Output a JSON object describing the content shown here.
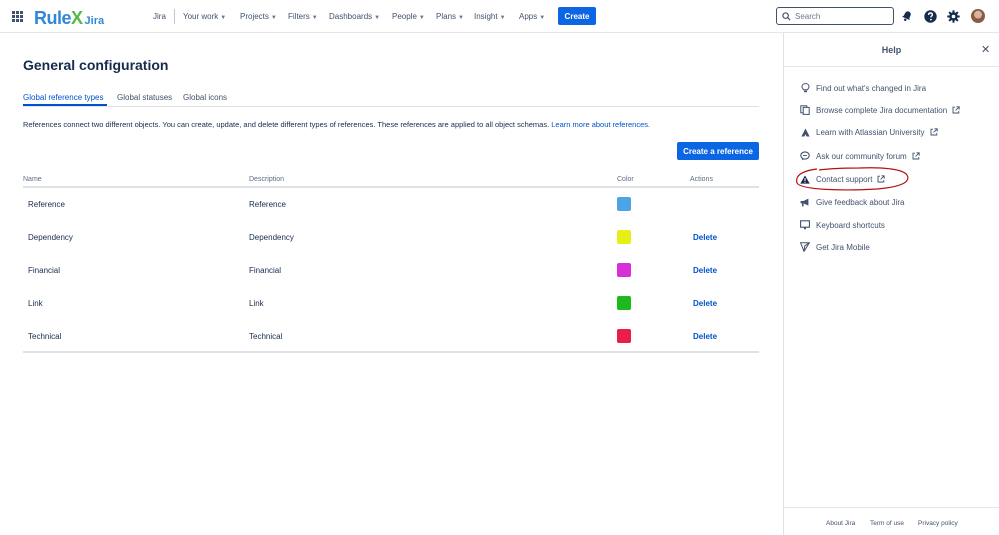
{
  "nav": {
    "brand_main": "Rule",
    "brand_x": "X",
    "brand_product": "Jira",
    "items": [
      {
        "label": "Jira",
        "chevron": false
      },
      {
        "label": "Your work",
        "chevron": true
      },
      {
        "label": "Projects",
        "chevron": true
      },
      {
        "label": "Filters",
        "chevron": true
      },
      {
        "label": "Dashboards",
        "chevron": true
      },
      {
        "label": "People",
        "chevron": true
      },
      {
        "label": "Plans",
        "chevron": true
      },
      {
        "label": "Insight",
        "chevron": true
      },
      {
        "label": "Apps",
        "chevron": true
      }
    ],
    "create_label": "Create",
    "search_placeholder": "Search",
    "icons": [
      "apps-grid-icon",
      "notifications-icon",
      "help-icon",
      "settings-icon",
      "avatar"
    ]
  },
  "page": {
    "title": "General configuration",
    "tabs": [
      {
        "label": "Global reference types",
        "active": true
      },
      {
        "label": "Global statuses",
        "active": false
      },
      {
        "label": "Global icons",
        "active": false
      }
    ],
    "description": "References connect two different objects. You can create, update, and delete different types of references. These references are applied to all object schemas.",
    "description_link": "Learn more about references.",
    "create_reference_label": "Create a reference"
  },
  "table": {
    "headers": {
      "name": "Name",
      "description": "Description",
      "color": "Color",
      "actions": "Actions"
    },
    "rows": [
      {
        "name": "Reference",
        "description": "Reference",
        "color": "#4ca3e6",
        "action": ""
      },
      {
        "name": "Dependency",
        "description": "Dependency",
        "color": "#e6ef16",
        "action": "Delete"
      },
      {
        "name": "Financial",
        "description": "Financial",
        "color": "#d62fd6",
        "action": "Delete"
      },
      {
        "name": "Link",
        "description": "Link",
        "color": "#1dba1d",
        "action": "Delete"
      },
      {
        "name": "Technical",
        "description": "Technical",
        "color": "#ea1c4a",
        "action": "Delete"
      }
    ]
  },
  "help": {
    "title": "Help",
    "items": [
      {
        "label": "Find out what's changed in Jira",
        "icon": "lightbulb-icon",
        "external": false
      },
      {
        "label": "Browse complete Jira documentation",
        "icon": "documentation-icon",
        "external": true
      },
      {
        "label": "Learn with Atlassian University",
        "icon": "atlassian-icon",
        "external": true
      },
      {
        "label": "Ask our community forum",
        "icon": "community-icon",
        "external": true
      },
      {
        "label": "Contact support",
        "icon": "support-icon",
        "external": true
      },
      {
        "label": "Give feedback about Jira",
        "icon": "feedback-icon",
        "external": false
      },
      {
        "label": "Keyboard shortcuts",
        "icon": "keyboard-icon",
        "external": false
      },
      {
        "label": "Get Jira Mobile",
        "icon": "mobile-icon",
        "external": false
      }
    ],
    "footer": [
      "About Jira",
      "Term of use",
      "Privacy policy"
    ]
  }
}
